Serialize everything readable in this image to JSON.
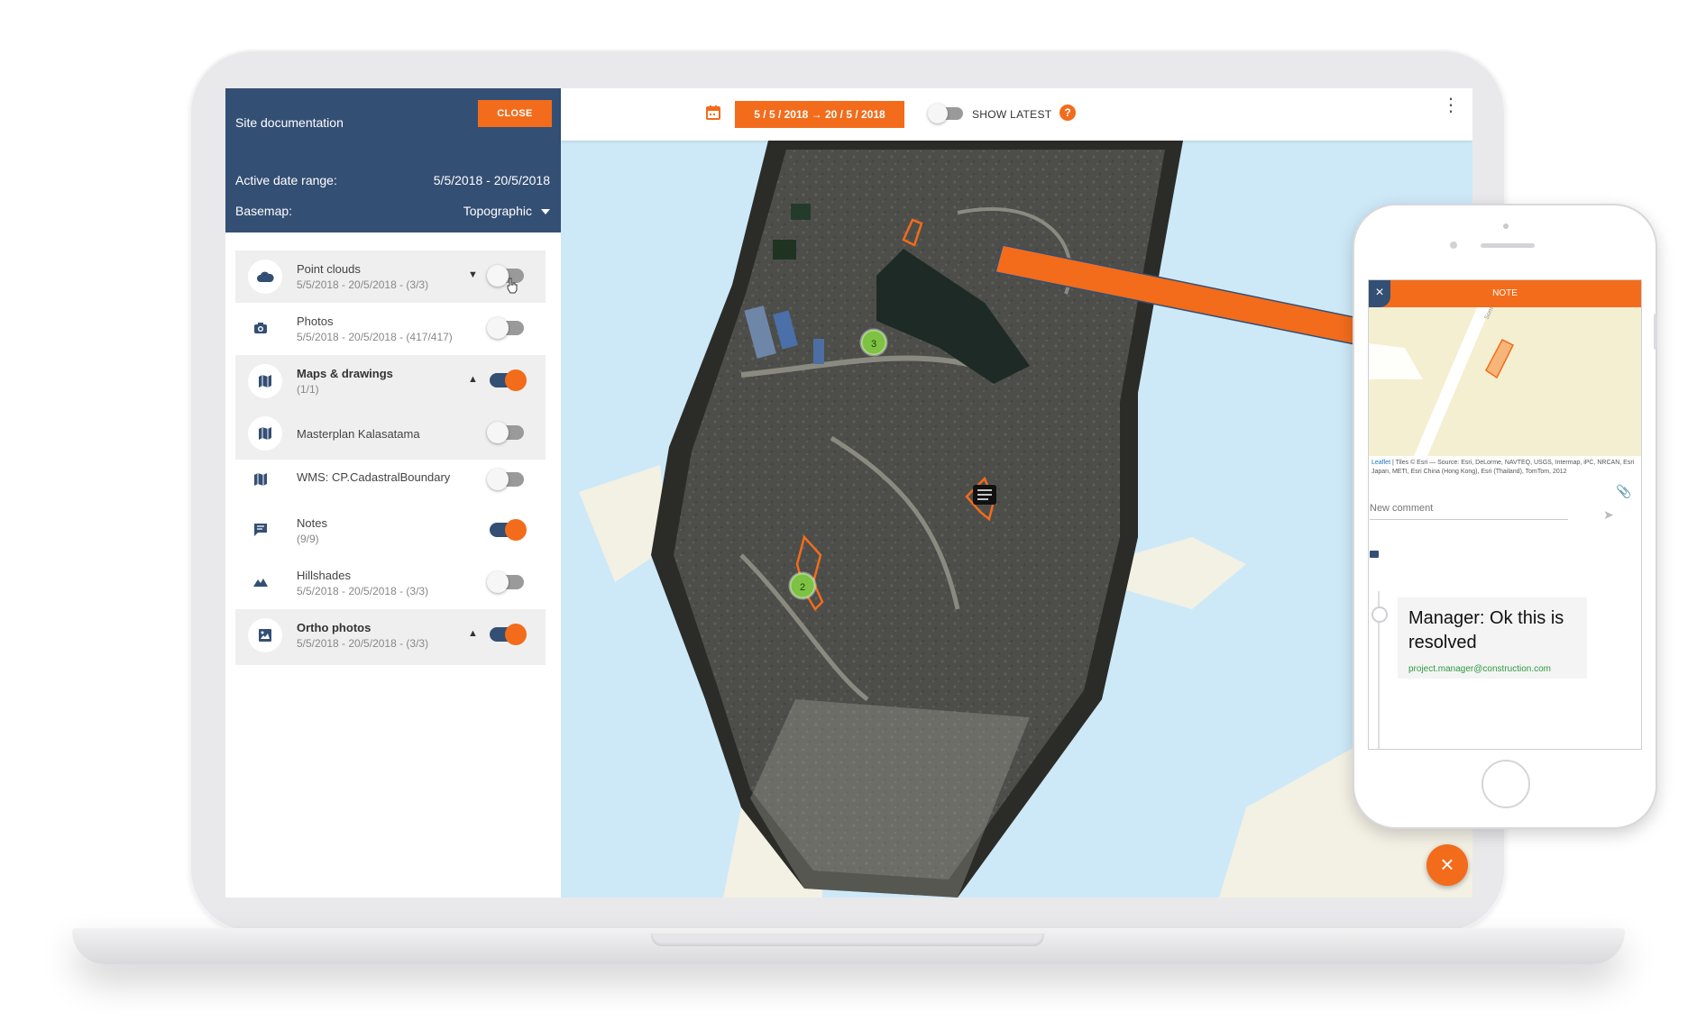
{
  "sidebar": {
    "title": "Site documentation",
    "close_label": "CLOSE",
    "date_range_label": "Active date range:",
    "date_range_value": "5/5/2018 - 20/5/2018",
    "basemap_label": "Basemap:",
    "basemap_value": "Topographic",
    "layers": [
      {
        "name": "Point clouds",
        "sub": "5/5/2018 - 20/5/2018 - (3/3)",
        "icon": "cloud-icon",
        "on": false,
        "arrow": "▼"
      },
      {
        "name": "Photos",
        "sub": "5/5/2018 - 20/5/2018 - (417/417)",
        "icon": "camera-icon",
        "on": false
      },
      {
        "name": "Maps & drawings",
        "sub": "(1/1)",
        "icon": "map-icon",
        "on": true,
        "arrow": "▲"
      },
      {
        "name": "Masterplan Kalasatama",
        "icon": "map-icon",
        "on": false
      },
      {
        "name": "WMS: CP.CadastralBoundary",
        "icon": "map-icon",
        "on": false
      },
      {
        "name": "Notes",
        "sub": "(9/9)",
        "icon": "comment-icon",
        "on": true
      },
      {
        "name": "Hillshades",
        "sub": "5/5/2018 - 20/5/2018 - (3/3)",
        "icon": "terrain-icon",
        "on": false
      },
      {
        "name": "Ortho photos",
        "sub": "5/5/2018 - 20/5/2018 - (3/3)",
        "icon": "image-icon",
        "on": true,
        "arrow": "▲"
      }
    ]
  },
  "topbar": {
    "date_button": "5 / 5 / 2018 → 20 / 5 / 2018",
    "show_latest_label": "SHOW LATEST",
    "help_label": "?"
  },
  "map": {
    "cluster_a": "3",
    "cluster_b": "2"
  },
  "fab": {
    "label": "×"
  },
  "phone": {
    "note_title": "NOTE",
    "close_label": "×",
    "attribution_link": "Leaflet",
    "attribution_text": " | Tiles © Esri — Source: Esri, DeLorme, NAVTEQ, USGS, Intermap, iPC, NRCAN, Esri Japan, METI, Esri China (Hong Kong), Esri (Thailand), TomTom, 2012",
    "comment_placeholder": "New comment",
    "comment_text": "Manager: Ok this is resolved",
    "comment_author": "project.manager@construction.com"
  },
  "colors": {
    "accent": "#f26c1c",
    "navy": "#344f74",
    "water": "#cde9f8",
    "cluster": "#7dc242"
  }
}
